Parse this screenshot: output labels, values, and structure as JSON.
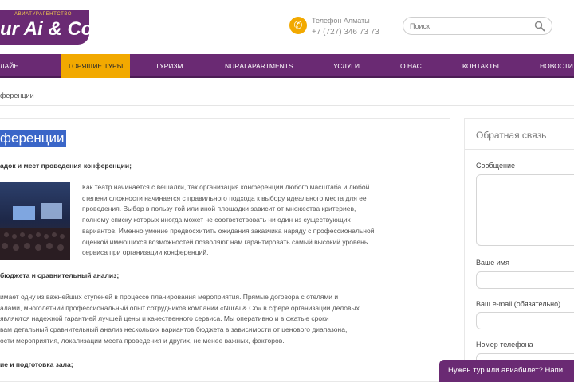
{
  "header": {
    "logo_sub": "Авиатурагентство",
    "logo_text": "ur Ai & Co",
    "phone_label": "Телефон Алматы",
    "phone_number": "+7 (727) 346 73 73",
    "phone_icon": "phone-icon",
    "search_placeholder": "Поиск",
    "search_icon": "search-icon"
  },
  "nav": {
    "items": [
      {
        "label": "лайн",
        "active": false
      },
      {
        "label": "Горящие туры",
        "active": true
      },
      {
        "label": "Туризм",
        "active": false
      },
      {
        "label": "NurAi Apartments",
        "active": false
      },
      {
        "label": "Услуги",
        "active": false
      },
      {
        "label": "О нас",
        "active": false
      },
      {
        "label": "Контакты",
        "active": false
      },
      {
        "label": "Новости",
        "active": false
      }
    ]
  },
  "breadcrumb": "ференции",
  "main": {
    "title": "ференции",
    "section1_heading": "адок и мест проведения конференции;",
    "paragraph1_lines": [
      "Как театр начинается с вешалки, так организация конференции любого масштаба и любой",
      "степени сложности начинается с правильного подхода к выбору идеального места для ее",
      "проведения. Выбор в пользу той или иной площадки зависит от множества критериев,",
      "полному списку которых иногда может не соответствовать ни один из существующих",
      "вариантов. Именно умение предвосхитить ожидания заказчика наряду с профессиональной",
      "оценкой имеющихся возможностей позволяют нам гарантировать самый высокий уровень",
      "сервиса при организации конференций."
    ],
    "section2_heading": "бюджета и сравнительный анализ;",
    "paragraph2_lines": [
      "имает одну из важнейших ступеней в процессе планирования мероприятия. Прямые договора с отелями и",
      "алами, многолетний профессиональный опыт сотрудников компании «NurAi & Co» в сфере организации деловых",
      "являются надежной гарантией лучшей цены и качественного сервиса. Мы оперативно и в сжатые сроки",
      "вам детальный сравнительный анализ нескольких вариантов бюджета в зависимости от ценового диапазона,",
      "ости мероприятия, локализации места проведения и других, не менее важных, факторов."
    ],
    "section3_heading": "ие и подготовка зала;"
  },
  "sidebar": {
    "title": "Обратная связь",
    "message_label": "Сообщение",
    "name_label": "Ваше имя",
    "email_label": "Ваш e-mail (обязательно)",
    "phone_label": "Номер телефона"
  },
  "promo_banner": "Нужен тур или авиабилет? Напи",
  "colors": {
    "brand_purple": "#6a2a73",
    "accent_orange": "#f2a900",
    "selection_blue": "#3a66c8"
  }
}
